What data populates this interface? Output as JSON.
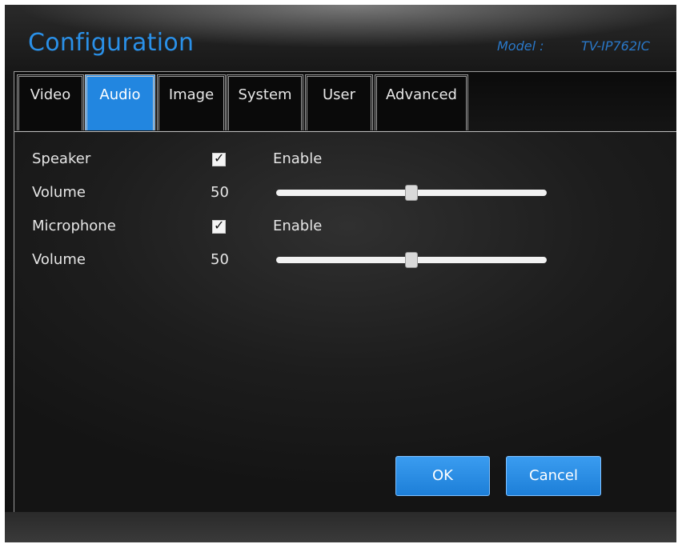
{
  "header": {
    "title": "Configuration",
    "model_label": "Model :",
    "model_value": "TV-IP762IC"
  },
  "tabs": [
    {
      "label": "Video",
      "active": false
    },
    {
      "label": "Audio",
      "active": true
    },
    {
      "label": "Image",
      "active": false
    },
    {
      "label": "System",
      "active": false
    },
    {
      "label": "User",
      "active": false
    },
    {
      "label": "Advanced",
      "active": false
    }
  ],
  "audio": {
    "speaker": {
      "label": "Speaker",
      "enabled": true,
      "enable_label": "Enable",
      "volume_label": "Volume",
      "volume": "50",
      "volume_fraction": 0.5
    },
    "microphone": {
      "label": "Microphone",
      "enabled": true,
      "enable_label": "Enable",
      "volume_label": "Volume",
      "volume": "50",
      "volume_fraction": 0.5
    }
  },
  "buttons": {
    "ok": "OK",
    "cancel": "Cancel"
  },
  "colors": {
    "accent": "#2286e0",
    "title": "#2a90e8",
    "background": "#1a1a1a"
  }
}
